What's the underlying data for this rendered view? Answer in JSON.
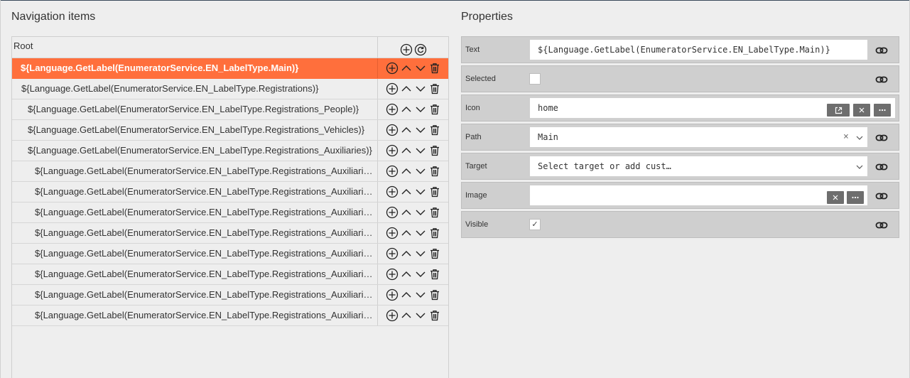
{
  "nav": {
    "title": "Navigation items",
    "root_label": "Root",
    "items": [
      {
        "label": "${Language.GetLabel(EnumeratorService.EN_LabelType.Main)}",
        "level": 0,
        "selected": true
      },
      {
        "label": "${Language.GetLabel(EnumeratorService.EN_LabelType.Registrations)}",
        "level": 1,
        "selected": false
      },
      {
        "label": "${Language.GetLabel(EnumeratorService.EN_LabelType.Registrations_People)}",
        "level": 2,
        "selected": false
      },
      {
        "label": "${Language.GetLabel(EnumeratorService.EN_LabelType.Registrations_Vehicles)}",
        "level": 2,
        "selected": false
      },
      {
        "label": "${Language.GetLabel(EnumeratorService.EN_LabelType.Registrations_Auxiliaries)}",
        "level": 2,
        "selected": false
      },
      {
        "label": "${Language.GetLabel(EnumeratorService.EN_LabelType.Registrations_Auxiliaries_...",
        "level": 3,
        "selected": false
      },
      {
        "label": "${Language.GetLabel(EnumeratorService.EN_LabelType.Registrations_Auxiliaries_...",
        "level": 3,
        "selected": false
      },
      {
        "label": "${Language.GetLabel(EnumeratorService.EN_LabelType.Registrations_Auxiliaries_...",
        "level": 3,
        "selected": false
      },
      {
        "label": "${Language.GetLabel(EnumeratorService.EN_LabelType.Registrations_Auxiliaries_I...",
        "level": 3,
        "selected": false
      },
      {
        "label": "${Language.GetLabel(EnumeratorService.EN_LabelType.Registrations_Auxiliaries_...",
        "level": 3,
        "selected": false
      },
      {
        "label": "${Language.GetLabel(EnumeratorService.EN_LabelType.Registrations_Auxiliaries_...",
        "level": 3,
        "selected": false
      },
      {
        "label": "${Language.GetLabel(EnumeratorService.EN_LabelType.Registrations_Auxiliaries_...",
        "level": 3,
        "selected": false
      },
      {
        "label": "${Language.GetLabel(EnumeratorService.EN_LabelType.Registrations_Auxiliaries_...",
        "level": 3,
        "selected": false
      }
    ],
    "row_icons": [
      "add-circle-icon",
      "move-up-icon",
      "move-down-icon",
      "trash-icon"
    ],
    "root_icons": [
      "add-circle-icon",
      "refresh-icon"
    ]
  },
  "props": {
    "title": "Properties",
    "text": {
      "label": "Text",
      "value": "${Language.GetLabel(EnumeratorService.EN_LabelType.Main)}"
    },
    "selected": {
      "label": "Selected",
      "checked": false
    },
    "icon": {
      "label": "Icon",
      "value": "home"
    },
    "path": {
      "label": "Path",
      "value": "Main"
    },
    "target": {
      "label": "Target",
      "placeholder": "Select target or add cust…"
    },
    "image": {
      "label": "Image",
      "value": ""
    },
    "visible": {
      "label": "Visible",
      "checked": true,
      "mark": "✓"
    }
  },
  "colors": {
    "selected_row": "#ff6f3c",
    "panel_bg": "#eeeeee",
    "prop_row_bg": "#cfcfcf",
    "button_bg": "#6e6e6e"
  }
}
